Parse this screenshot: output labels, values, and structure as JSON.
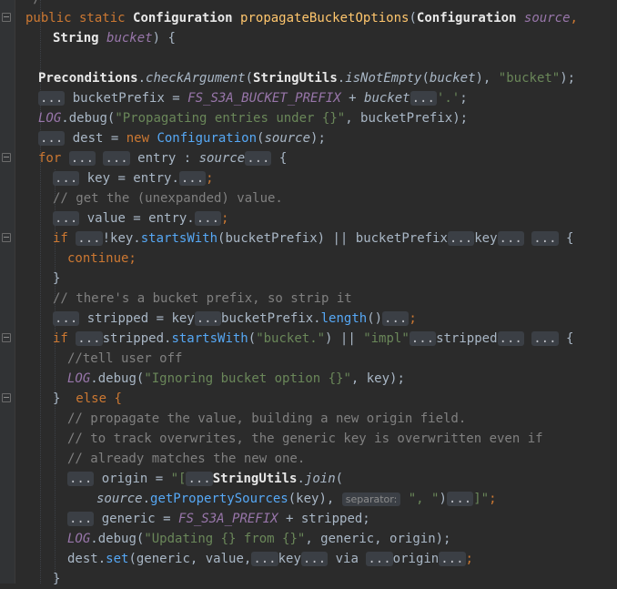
{
  "top_fragment": "*/",
  "signature": {
    "l1": {
      "kw": "public static ",
      "type": "Configuration",
      "name": "propagateBucketOptions",
      "open": "(",
      "ptype": "Configuration",
      "pname": "source",
      "comma": ","
    },
    "l2": {
      "ptype": "String",
      "pname": "bucket",
      "close": ") {"
    }
  },
  "body": {
    "precond": {
      "cls": "Preconditions",
      "dot": ".",
      "method": "checkArgument",
      "open": "(",
      "cls2": "StringUtils",
      "dot2": ".",
      "method2": "isNotEmpty",
      "open2": "(",
      "arg": "bucket",
      "close2": "), ",
      "str": "\"bucket\"",
      "end": ");"
    },
    "prefix": {
      "fold": "...",
      "t1": " bucketPrefix = ",
      "const": "FS_S3A_BUCKET_PREFIX",
      "t2": " + ",
      "var": "bucket",
      "fold2": "...",
      "str": "'.'",
      "end": ";"
    },
    "log1": {
      "obj": "LOG",
      "method": ".debug(",
      "str": "\"Propagating entries under {}\"",
      "end": ", bucketPrefix);"
    },
    "dest": {
      "fold": "...",
      "t1": " dest = ",
      "kw": "new ",
      "type": "Configuration",
      "open": "(",
      "arg": "source",
      "end": ");"
    },
    "for": {
      "kw": "for ",
      "f1": "...",
      "f2": "...",
      "t1": " entry : ",
      "src": "source",
      "f3": "...",
      "end": " {"
    },
    "key": {
      "fold": "...",
      "t1": " key = entry.",
      "fold2": "...",
      "end": ";"
    },
    "c1": "// get the (unexpanded) value.",
    "value": {
      "fold": "...",
      "t1": " value = entry.",
      "fold2": "...",
      "end": ";"
    },
    "if1": {
      "kw": "if ",
      "f1": "...",
      "t1": "!key.",
      "method": "startsWith",
      "t2": "(bucketPrefix) ",
      "or": "||",
      "t3": " bucketPrefix",
      "f2": "...",
      "t4": "key",
      "f3": "...",
      "f4": "...",
      "end": " {"
    },
    "cont": "continue;",
    "close1": "}",
    "c2": "// there's a bucket prefix, so strip it",
    "stripped": {
      "fold": "...",
      "t1": " stripped = key",
      "f2": "...",
      "t2": "bucketPrefix.",
      "method": "length",
      "t3": "()",
      "f3": "...",
      "end": ";"
    },
    "if2": {
      "kw": "if ",
      "f1": "...",
      "t1": "stripped.",
      "method": "startsWith",
      "t2": "(",
      "str": "\"bucket.\"",
      "t3": ") ",
      "or": "||",
      "str2": " \"impl\"",
      "f2": "...",
      "t4": "stripped",
      "f3": "...",
      "f4": "...",
      "end": " {"
    },
    "c3": "//tell user off",
    "log2": {
      "obj": "LOG",
      "method": ".debug(",
      "str": "\"Ignoring bucket option {}\"",
      "end": ", key);"
    },
    "else": {
      "brace": "}",
      "kw": "  else {"
    },
    "c4": "// propagate the value, building a new origin field.",
    "c5": "// to track overwrites, the generic key is overwritten even if",
    "c6": "// already matches the new one.",
    "origin": {
      "fold": "...",
      "t1": " origin = ",
      "str": "\"[",
      "f2": "...",
      "cls": "StringUtils",
      "dot": ".",
      "method": "join",
      "open": "("
    },
    "origin2": {
      "src": "source",
      "dot": ".",
      "method": "getPropertySources",
      "t1": "(key), ",
      "hint": "separator:",
      "str": " \", \"",
      "t2": ")",
      "f3": "...",
      "str2": "]\"",
      "end": ";"
    },
    "generic": {
      "fold": "...",
      "t1": " generic = ",
      "const": "FS_S3A_PREFIX",
      "end": " + stripped;"
    },
    "log3": {
      "obj": "LOG",
      "method": ".debug(",
      "str": "\"Updating {} from {}\"",
      "end": ", generic, origin);"
    },
    "set": {
      "t1": "dest.",
      "method": "set",
      "t2": "(generic, value,",
      "f1": "...",
      "t3": "key",
      "f2": "...",
      "t4": " via ",
      "f3": "...",
      "t5": "origin",
      "f4": "...",
      "end": ";"
    },
    "close2": "}"
  },
  "colors": {
    "background": "#2b2b2b",
    "keyword": "#cc7832",
    "string": "#6a8759",
    "comment": "#808080",
    "constant": "#9876aa",
    "method": "#ffc66d"
  }
}
